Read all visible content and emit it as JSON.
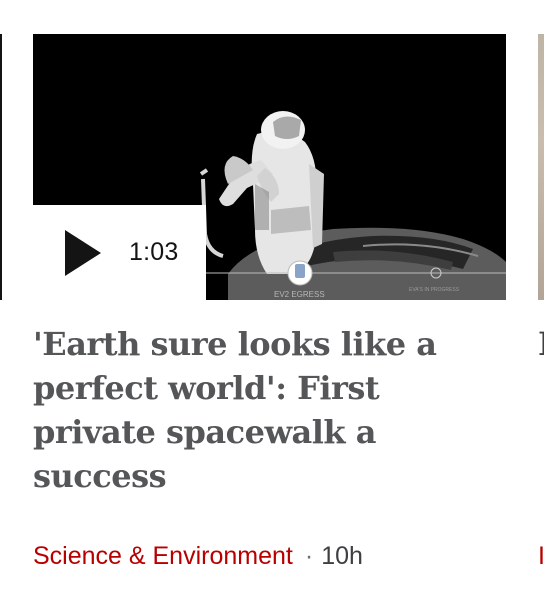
{
  "card": {
    "video": {
      "duration": "1:03",
      "hud_left": "EV2 EGRESS",
      "hud_right": "EVA'S IN PROGRESS"
    },
    "headline": "'Earth sure looks like a perfect world': First private spacewalk a success",
    "section": "Science & Environment",
    "separator": "·",
    "timestamp": "10h",
    "icons": {
      "play": "play-icon"
    }
  },
  "next_card": {
    "headline_fragment": "I",
    "meta_fragment": "I"
  },
  "colors": {
    "section_link": "#b80000",
    "headline": "#545658",
    "overlay_bg": "#ffffff"
  }
}
